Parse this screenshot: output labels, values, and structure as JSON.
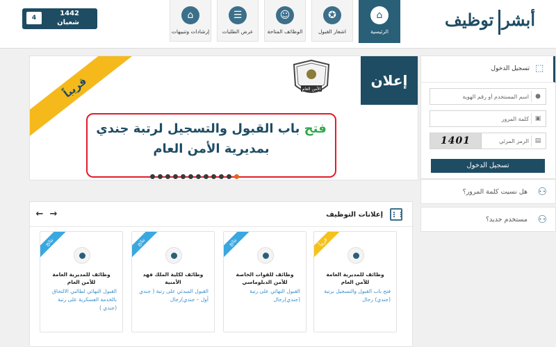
{
  "header": {
    "date": {
      "num": "4",
      "year": "1442",
      "month": "شعبان"
    },
    "nav": [
      {
        "label": "الرئيسية",
        "icon": "home-icon",
        "active": true
      },
      {
        "label": "اشعار القبول",
        "icon": "badge-icon",
        "active": false
      },
      {
        "label": "الوظائف المتاحة",
        "icon": "users-icon",
        "active": false
      },
      {
        "label": "عرض الطلبات",
        "icon": "user-list-icon",
        "active": false
      },
      {
        "label": "إرشادات وتنبيهات",
        "icon": "home-alert-icon",
        "active": false
      }
    ],
    "logo": {
      "part1": "أبشر",
      "part2": "توظيف"
    }
  },
  "banner": {
    "ribbon": "قريباً",
    "tag": "إعلان",
    "emblem_text": "الأمن العام",
    "line1_highlight": "فتح",
    "line1_rest": " باب القبول والتسجيل لرتبة جندي",
    "line2": "بمديرية الأمن العام",
    "dots_count": 12,
    "active_dot": 11
  },
  "login": {
    "title": "تسجيل الدخول",
    "username_placeholder": "اسم المستخدم أو رقم الهوية",
    "password_placeholder": "كلمة المرور",
    "captcha_placeholder": "الرمز المرئي",
    "captcha_value": "1401",
    "button": "تسجيل الدخول"
  },
  "links": {
    "forgot": "هل نسيت كلمة المرور؟",
    "new_user": "مستخدم جديد؟"
  },
  "jobs": {
    "title": "إعلانات التوظيف",
    "cards": [
      {
        "ribbon": "قريباً",
        "ribbon_color": "#f5c21b",
        "title": "وظائف للمديرية العامة للأمن العام",
        "desc": "فتح باب القبول والتسجيل برتبة (جندي) رجال"
      },
      {
        "ribbon": "نتائج",
        "ribbon_color": "#3aa8e0",
        "title": "وظائف للقوات الخاصة للأمن الدبلوماسي",
        "desc": "القبول النهائي على رتبة (جندي)رجال"
      },
      {
        "ribbon": "نتائج",
        "ribbon_color": "#3aa8e0",
        "title": "وظائف لكلية الملك فهد الأمنية",
        "desc": "القبول المبدئي على رتبة ( جندي أول – جندي)رجال"
      },
      {
        "ribbon": "نتائج",
        "ribbon_color": "#3aa8e0",
        "title": "وظائف للمديرية العامة للأمن العام",
        "desc": "القبول النهائي لطالبي الالتحاق بالخدمة العسكرية على رتبة (جندي )"
      }
    ]
  }
}
